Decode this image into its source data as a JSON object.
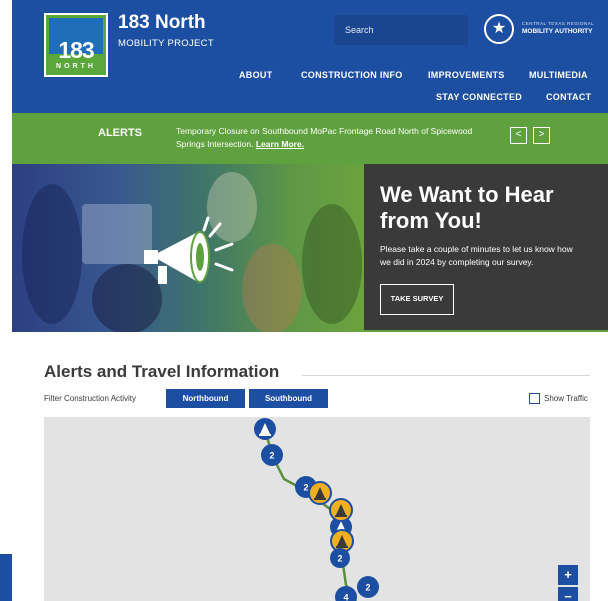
{
  "brand": {
    "title": "183 North",
    "subtitle": "MOBILITY PROJECT",
    "logo_number": "183",
    "logo_word": "NORTH"
  },
  "search": {
    "placeholder": "Search"
  },
  "partner": {
    "line1": "CENTRAL TEXAS REGIONAL",
    "line2": "MOBILITY AUTHORITY"
  },
  "nav": {
    "row1": [
      "ABOUT",
      "CONSTRUCTION INFO",
      "IMPROVEMENTS",
      "MULTIMEDIA"
    ],
    "row2": [
      "STAY CONNECTED",
      "CONTACT"
    ]
  },
  "alerts": {
    "label": "ALERTS",
    "text": "Temporary Closure on Southbound MoPac Frontage Road North of Spicewood Springs Intersection.",
    "link": "Learn More.",
    "prev": "<",
    "next": ">"
  },
  "hero": {
    "title": "We Want to Hear from You!",
    "description": "Please take a couple of minutes to let us know how we did in 2024 by completing our survey.",
    "button": "TAKE SURVEY"
  },
  "section": {
    "title": "Alerts and Travel Information",
    "filter_label": "Filter Construction Activity",
    "northbound": "Northbound",
    "southbound": "Southbound",
    "show_traffic": "Show Traffic"
  },
  "map": {
    "zoom_in": "+",
    "zoom_out": "−",
    "cluster_labels": [
      "2",
      "2",
      "2",
      "2",
      "4"
    ]
  },
  "colors": {
    "brand_blue": "#1c4fa1",
    "alert_green": "#5fa13e",
    "hero_dark": "#3a3a3a",
    "marker_yellow": "#f2b01e"
  }
}
